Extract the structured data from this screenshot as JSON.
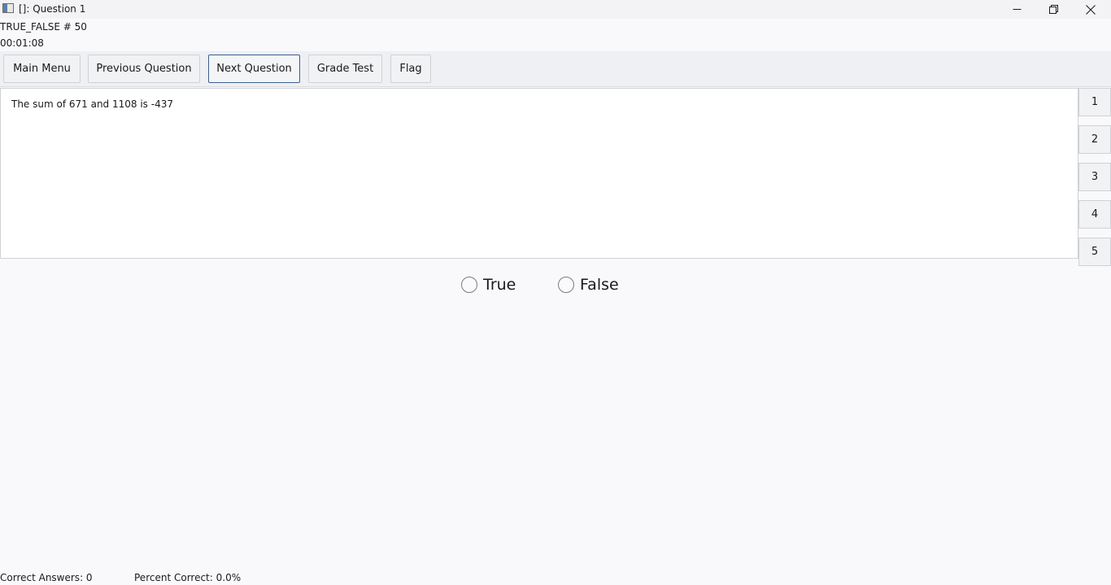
{
  "window": {
    "title": "[]: Question 1",
    "controls": {
      "minimize": "minimize-icon",
      "restore": "restore-icon",
      "close": "close-icon"
    }
  },
  "info": {
    "question_type": "TRUE_FALSE # 50",
    "timer": "00:01:08"
  },
  "toolbar": {
    "main_menu_label": "Main Menu",
    "previous_label": "Previous Question",
    "next_label": "Next Question",
    "grade_label": "Grade Test",
    "flag_label": "Flag"
  },
  "question": {
    "text": "The sum of 671 and 1108 is -437"
  },
  "question_nav": [
    "1",
    "2",
    "3",
    "4",
    "5"
  ],
  "answers": {
    "true_label": "True",
    "false_label": "False",
    "selected": null
  },
  "footer": {
    "correct_answers": "Correct Answers: 0",
    "percent_correct": "Percent Correct: 0.0%"
  }
}
